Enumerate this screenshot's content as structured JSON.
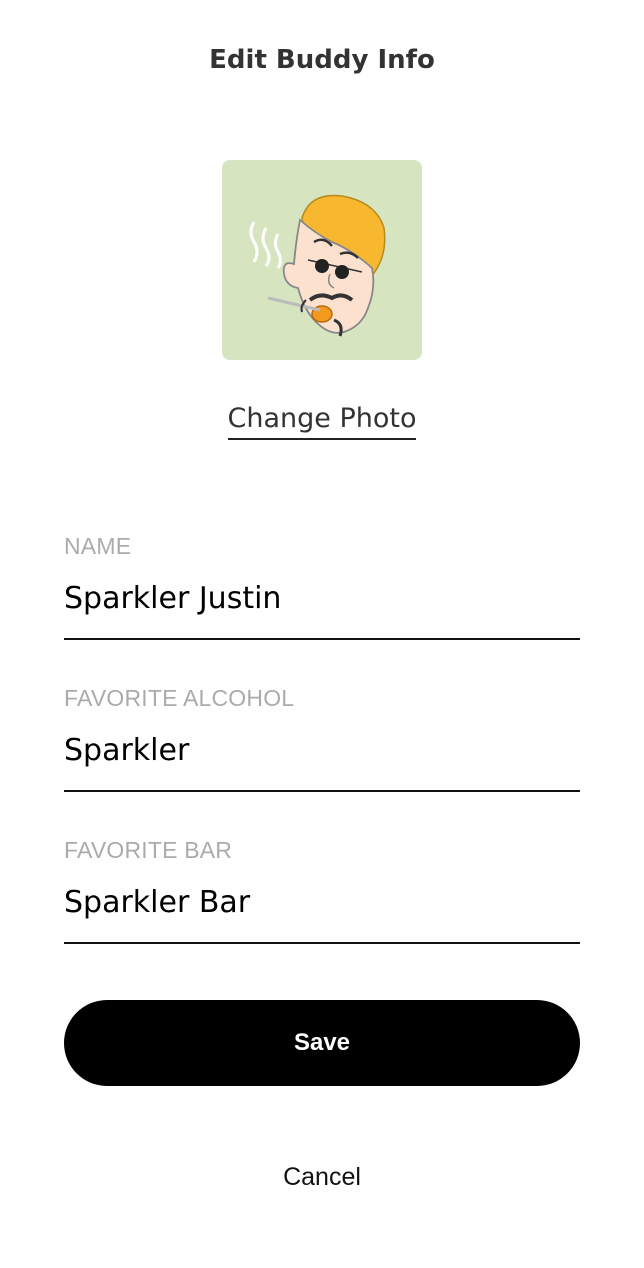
{
  "header": {
    "title": "Edit Buddy Info"
  },
  "avatar": {
    "icon": "cartoon-smoking-man-avatar",
    "background_color": "#d6e4c0"
  },
  "change_photo_label": "Change Photo",
  "form": {
    "name": {
      "label": "NAME",
      "value": "Sparkler Justin"
    },
    "favorite_alcohol": {
      "label": "FAVORITE ALCOHOL",
      "value": "Sparkler"
    },
    "favorite_bar": {
      "label": "FAVORITE BAR",
      "value": "Sparkler Bar"
    }
  },
  "actions": {
    "save_label": "Save",
    "cancel_label": "Cancel"
  },
  "colors": {
    "primary_button": "#000000",
    "label_gray": "#ababab",
    "title_text": "#333333"
  }
}
